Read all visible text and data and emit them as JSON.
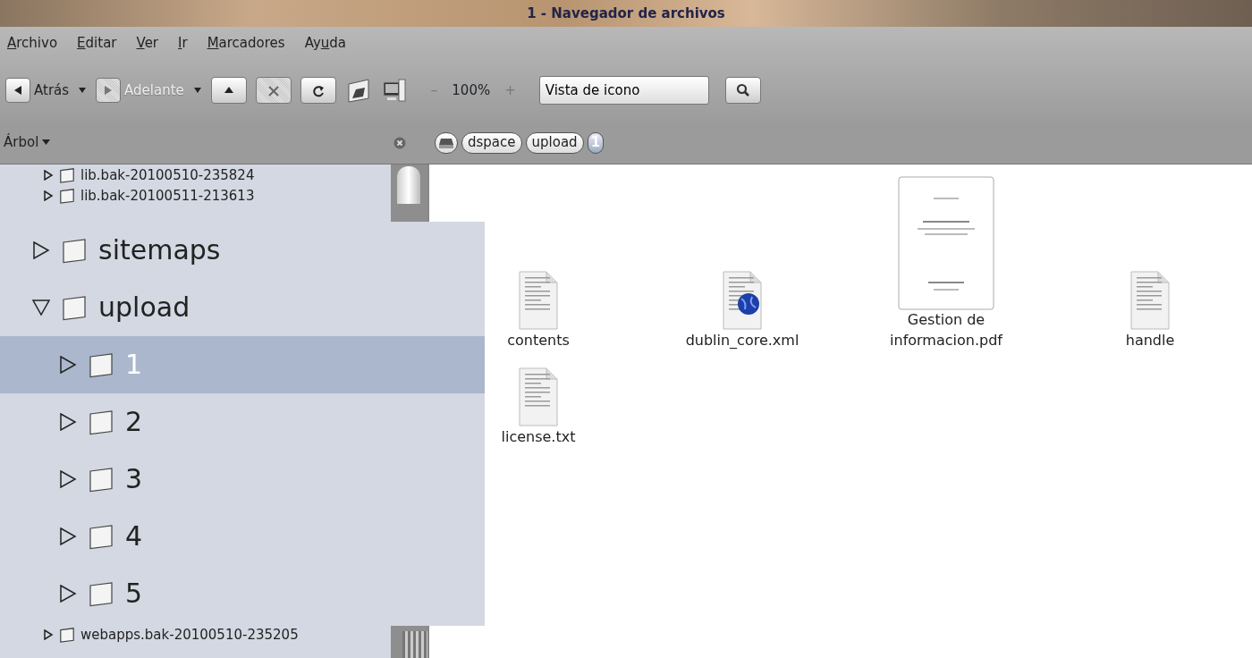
{
  "window": {
    "title": "1 - Navegador de archivos"
  },
  "menu": [
    {
      "key": "A",
      "after": "rchivo"
    },
    {
      "key": "E",
      "after": "ditar"
    },
    {
      "key": "V",
      "after": "er"
    },
    {
      "key": "I",
      "after": "r"
    },
    {
      "key": "M",
      "after": "arcadores"
    },
    {
      "before": "Ay",
      "key": "u",
      "after": "da"
    }
  ],
  "toolbar": {
    "buttons": [
      {
        "kind": "back",
        "label": "Atrás",
        "disabled": false,
        "dropdown": true
      },
      {
        "kind": "forward",
        "label": "Adelante",
        "disabled": true,
        "dropdown": true
      },
      {
        "kind": "up",
        "disabled": false
      },
      {
        "kind": "stop",
        "disabled": true
      },
      {
        "kind": "reload",
        "disabled": false
      },
      {
        "kind": "home",
        "disabled": false
      },
      {
        "kind": "computer",
        "disabled": false
      }
    ],
    "zoom": {
      "minus": "–",
      "value": "100%",
      "plus": "+"
    },
    "view_select": {
      "value": "Vista de icono"
    }
  },
  "location": {
    "sidebar_select": "Árbol",
    "path": [
      {
        "kind": "disk",
        "selected": false
      },
      {
        "kind": "folder",
        "label": "dspace",
        "selected": false
      },
      {
        "kind": "folder",
        "label": "upload",
        "selected": false
      },
      {
        "kind": "folder",
        "label": "1",
        "selected": true
      }
    ]
  },
  "tree": {
    "items_above": [
      {
        "label": "lib.bak-20100510-235824",
        "expanded": false
      },
      {
        "label": "lib.bak-20100511-213613",
        "expanded": false
      }
    ],
    "items_below": [
      {
        "label": "webapps.bak-20100510-235205",
        "expanded": false
      }
    ]
  },
  "magnifier": {
    "items": [
      {
        "label": "sitemaps",
        "expanded": false,
        "selected": false
      },
      {
        "label": "upload",
        "expanded": true,
        "selected": false,
        "children": [
          {
            "label": "1",
            "expanded": false,
            "selected": true
          },
          {
            "label": "2",
            "expanded": false,
            "selected": false
          },
          {
            "label": "3",
            "expanded": false,
            "selected": false
          },
          {
            "label": "4",
            "expanded": false,
            "selected": false
          },
          {
            "label": "5",
            "expanded": false,
            "selected": false
          }
        ]
      }
    ]
  },
  "files": [
    {
      "name": "contents",
      "kind": "text"
    },
    {
      "name": "dublin_core.xml",
      "kind": "xml"
    },
    {
      "name": "Gestion de informacion.pdf",
      "kind": "pdf"
    },
    {
      "name": "handle",
      "kind": "text"
    },
    {
      "name": "license.txt",
      "kind": "text"
    }
  ]
}
